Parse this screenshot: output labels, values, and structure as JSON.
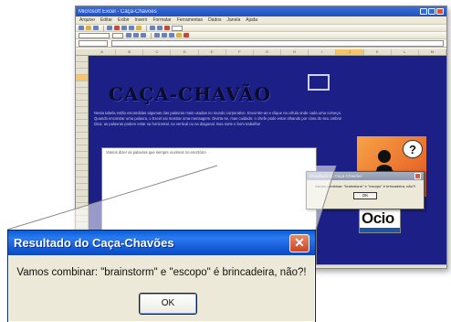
{
  "excel": {
    "title": "Microsoft Excel - Caça-Chavões",
    "menu": [
      "Arquivo",
      "Editar",
      "Exibir",
      "Inserir",
      "Formatar",
      "Ferramentas",
      "Dados",
      "Janela",
      "Ajuda"
    ],
    "columns": [
      "A",
      "B",
      "C",
      "D",
      "E",
      "F",
      "G",
      "H",
      "I",
      "J",
      "K",
      "L",
      "M"
    ],
    "sheet_title": "CAÇA-CHAVÃO",
    "instructions": [
      "Nesta tabela estão escondidas algumas das palavras mais usadas no mundo corporativo. Encontre-as e clique na célula onde cada uma começa.",
      "Quando encontrar uma palavra, o Excel vai mostrar uma mensagem. Divirta-se, mas cuidado: o chefe pode estar olhando por cima do seu ombro!",
      "Dica: as palavras podem estar na horizontal, na vertical ou na diagonal. Boa sorte e bom trabalho!"
    ],
    "word_box_text": "Vamos dizer as palavras que sempre ouvimos no escritório",
    "mascot_symbol": "?",
    "logo_text": "Ocio"
  },
  "mini_dialog": {
    "title": "Resultado do Caça-Chavões",
    "message": "Vamos combinar: \"brainstorm\" e \"escopo\" é brincadeira, não?!",
    "ok_label": "OK"
  },
  "dialog": {
    "title": "Resultado do Caça-Chavões",
    "message": "Vamos combinar: \"brainstorm\" e \"escopo\" é brincadeira, não?!",
    "ok_label": "OK",
    "close_symbol": "✕"
  },
  "colors": {
    "sheet_background": "#1c1f86",
    "title_bar": "#1255d0",
    "accent_orange": "#e2551f"
  }
}
